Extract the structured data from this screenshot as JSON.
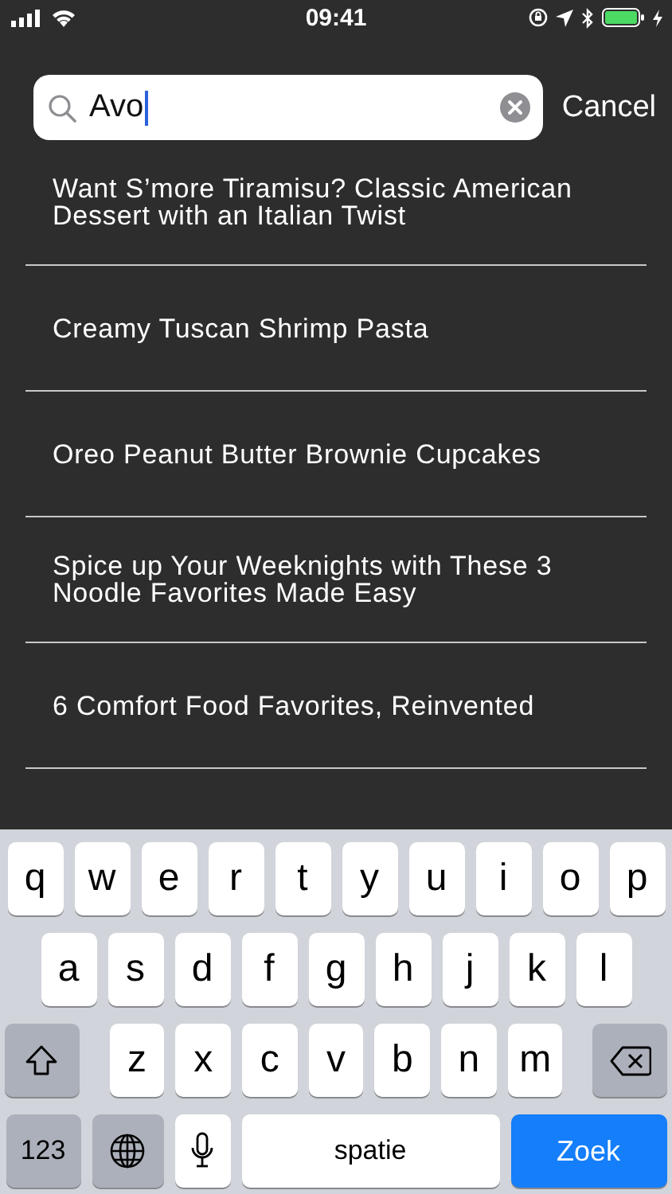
{
  "status_bar": {
    "time": "09:41"
  },
  "search": {
    "value": "Avo",
    "cancel": "Cancel"
  },
  "results": [
    {
      "title": "Want S’more Tiramisu? Classic American Dessert with an Italian Twist"
    },
    {
      "title": "Creamy Tuscan Shrimp Pasta"
    },
    {
      "title": "Oreo Peanut Butter Brownie Cupcakes"
    },
    {
      "title": "Spice up Your Weeknights with These 3 Noodle Favorites Made Easy"
    },
    {
      "title": "6 Comfort Food Favorites, Reinvented"
    }
  ],
  "keyboard": {
    "letter_rows": [
      {
        "keys": [
          "q",
          "w",
          "e",
          "r",
          "t",
          "y",
          "u",
          "i",
          "o",
          "p"
        ]
      },
      {
        "keys": [
          "a",
          "s",
          "d",
          "f",
          "g",
          "h",
          "j",
          "k",
          "l"
        ]
      },
      {
        "keys": [
          "z",
          "x",
          "c",
          "v",
          "b",
          "n",
          "m"
        ]
      }
    ],
    "numbers_key": "123",
    "space_key": "spatie",
    "return_key": "Zoek"
  }
}
